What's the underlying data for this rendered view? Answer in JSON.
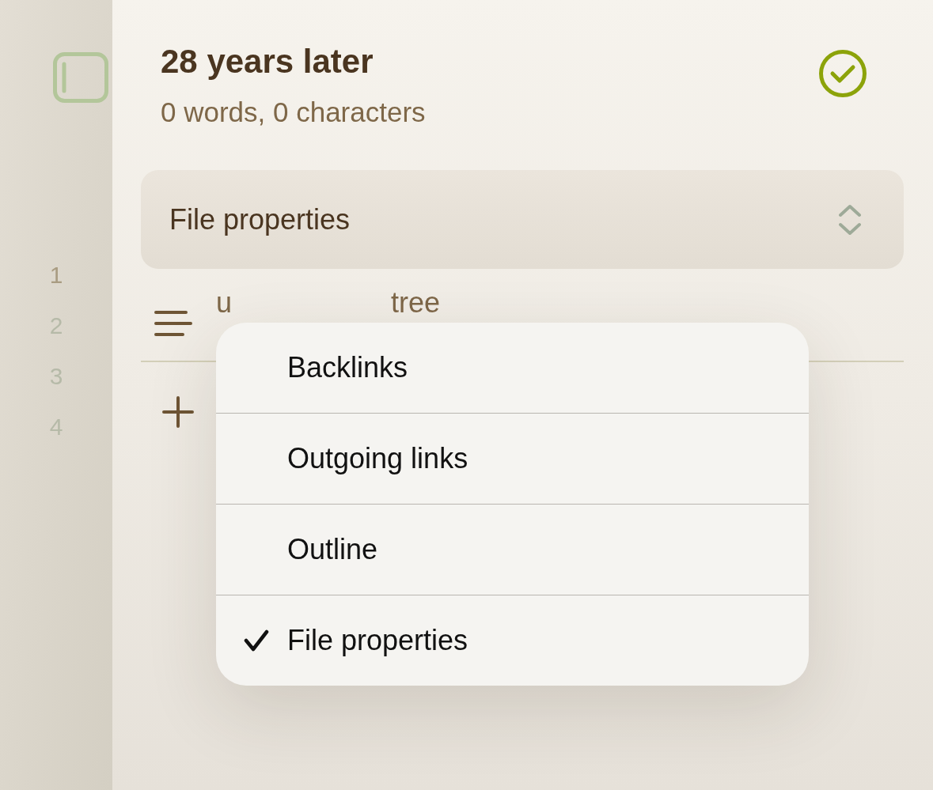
{
  "gutter": {
    "line_numbers": [
      {
        "text": "1",
        "current": true
      },
      {
        "text": "2",
        "current": false
      },
      {
        "text": "3",
        "current": false
      },
      {
        "text": "4",
        "current": false
      }
    ]
  },
  "note": {
    "title": "28 years later",
    "stats": "0 words, 0 characters"
  },
  "properties_panel": {
    "title": "File properties",
    "properties": [
      {
        "key": "u",
        "value": "tree"
      }
    ]
  },
  "menu": {
    "items": [
      {
        "label": "Backlinks",
        "selected": false
      },
      {
        "label": "Outgoing links",
        "selected": false
      },
      {
        "label": "Outline",
        "selected": false
      },
      {
        "label": "File properties",
        "selected": true
      }
    ]
  }
}
